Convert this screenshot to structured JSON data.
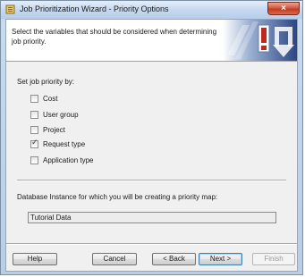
{
  "window": {
    "title": "Job Prioritization Wizard - Priority Options",
    "close_glyph": "×"
  },
  "header": {
    "instruction": "Select the variables that should be considered when determining job priority."
  },
  "priority": {
    "section_label": "Set job priority by:",
    "options": [
      {
        "label": "Cost",
        "checked": false
      },
      {
        "label": "User group",
        "checked": false
      },
      {
        "label": "Project",
        "checked": false
      },
      {
        "label": "Request type",
        "checked": true
      },
      {
        "label": "Application type",
        "checked": false
      }
    ]
  },
  "database": {
    "label": "Database Instance for which you will be creating a priority map:",
    "value": "Tutorial Data"
  },
  "buttons": {
    "help": "Help",
    "cancel": "Cancel",
    "back": "< Back",
    "next": "Next >",
    "finish": "Finish"
  },
  "colors": {
    "banner_red": "#c0281e",
    "banner_blue": "#2e4a86"
  }
}
